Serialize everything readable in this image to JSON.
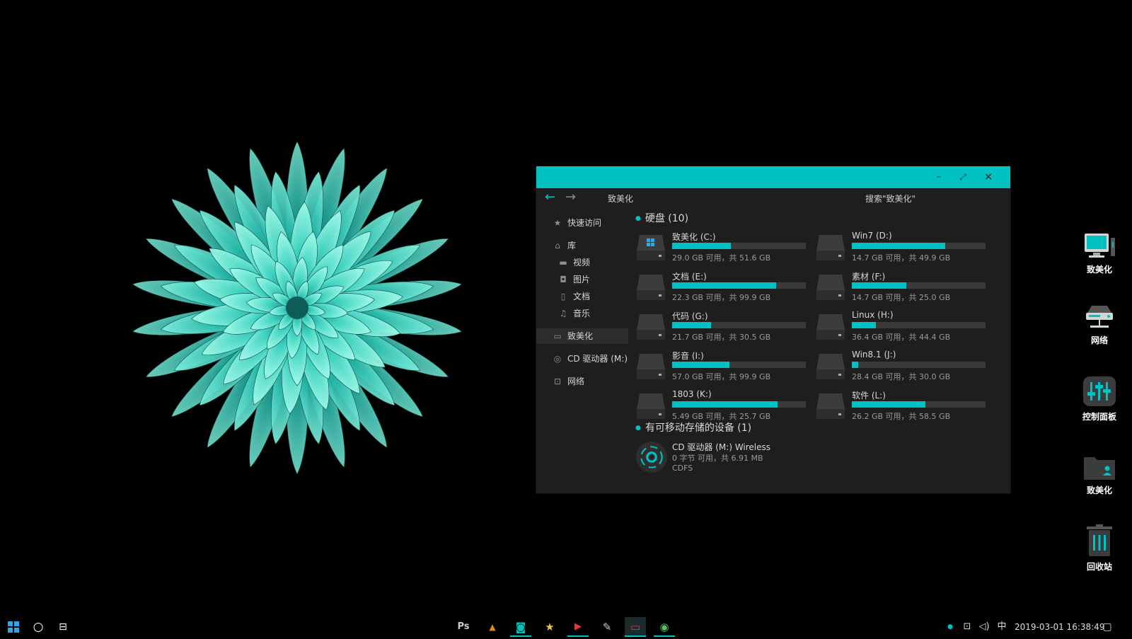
{
  "explorer": {
    "title_buttons": {
      "minimize": "–",
      "maximize": "⤢",
      "close": "✕"
    },
    "nav": {
      "back": "←",
      "forward": "→"
    },
    "address": "致美化",
    "search_placeholder": "搜索\"致美化\"",
    "sidebar": {
      "quick_access": "快速访问",
      "library": "库",
      "library_items": [
        "视频",
        "图片",
        "文档",
        "音乐"
      ],
      "this_pc": "致美化",
      "cd_drive": "CD 驱动器 (M:)",
      "network": "网络"
    },
    "drives_section": "硬盘 (10)",
    "drives": [
      {
        "name": "致美化 (C:)",
        "free": "29.0 GB 可用，共 51.6 GB",
        "used_fraction": 0.44,
        "system": true
      },
      {
        "name": "Win7 (D:)",
        "free": "14.7 GB 可用，共 49.9 GB",
        "used_fraction": 0.7,
        "system": false
      },
      {
        "name": "文档 (E:)",
        "free": "22.3 GB 可用，共 99.9 GB",
        "used_fraction": 0.78,
        "system": false
      },
      {
        "name": "素材 (F:)",
        "free": "14.7 GB 可用，共 25.0 GB",
        "used_fraction": 0.41,
        "system": false
      },
      {
        "name": "代码 (G:)",
        "free": "21.7 GB 可用，共 30.5 GB",
        "used_fraction": 0.29,
        "system": false
      },
      {
        "name": "Linux (H:)",
        "free": "36.4 GB 可用，共 44.4 GB",
        "used_fraction": 0.18,
        "system": false
      },
      {
        "name": "影音 (I:)",
        "free": "57.0 GB 可用，共 99.9 GB",
        "used_fraction": 0.43,
        "system": false
      },
      {
        "name": "Win8.1 (J:)",
        "free": "28.4 GB 可用，共 30.0 GB",
        "used_fraction": 0.05,
        "system": false
      },
      {
        "name": "1803 (K:)",
        "free": "5.49 GB 可用，共 25.7 GB",
        "used_fraction": 0.79,
        "system": false
      },
      {
        "name": "软件 (L:)",
        "free": "26.2 GB 可用，共 58.5 GB",
        "used_fraction": 0.55,
        "system": false
      }
    ],
    "removable_section": "有可移动存储的设备 (1)",
    "cd_device": {
      "name": "CD 驱动器 (M:) Wireless",
      "free": "0 字节 可用，共 6.91 MB",
      "fs": "CDFS"
    }
  },
  "desktop_icons": [
    {
      "label": "致美化",
      "icon": "computer-icon"
    },
    {
      "label": "网络",
      "icon": "network-icon"
    },
    {
      "label": "控制面板",
      "icon": "control-panel-icon"
    },
    {
      "label": "致美化",
      "icon": "user-folder-icon"
    },
    {
      "label": "回收站",
      "icon": "recycle-bin-icon"
    }
  ],
  "taskbar": {
    "apps": [
      {
        "name": "photoshop",
        "glyph": "Ps"
      },
      {
        "name": "vlc",
        "glyph": "▲"
      },
      {
        "name": "camera",
        "glyph": "◙"
      },
      {
        "name": "favorites",
        "glyph": "★"
      },
      {
        "name": "video-player",
        "glyph": "▶"
      },
      {
        "name": "notepad",
        "glyph": "✎"
      },
      {
        "name": "display",
        "glyph": "▭"
      },
      {
        "name": "chrome",
        "glyph": "◉"
      }
    ],
    "ime": "中",
    "datetime": "2019-03-01  16:38:49"
  },
  "colors": {
    "accent": "#00c2c2",
    "window_bg": "#1e1e1e",
    "bar_bg": "#3a3a3a"
  }
}
